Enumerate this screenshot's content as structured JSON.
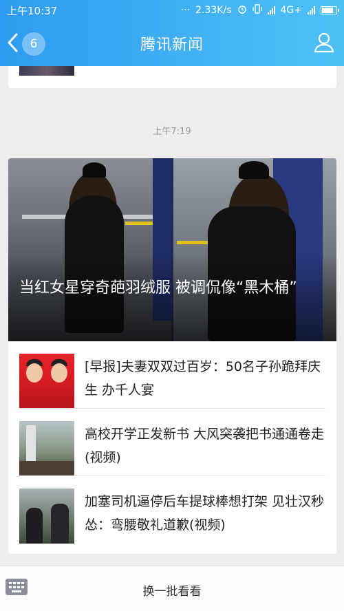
{
  "status_bar": {
    "time": "上午10:37",
    "speed": "2.33K/s",
    "network": "4G+"
  },
  "navbar": {
    "back_count": "6",
    "title": "腾讯新闻"
  },
  "timestamp": "上午7:19",
  "hero": {
    "headline": "当红女星穿奇葩羽绒服 被调侃像“黑木桶”"
  },
  "news_items": [
    {
      "title": "[早报]夫妻双双过百岁：50名子孙跪拜庆生 办千人宴"
    },
    {
      "title": "高校开学正发新书 大风突袭把书通通卷走(视频)"
    },
    {
      "title": "加塞司机逼停后车提球棒想打架 见壮汉秒怂：弯腰敬礼道歉(视频)"
    }
  ],
  "bottom": {
    "refresh_label": "换一批看看"
  },
  "colors": {
    "accent_start": "#2f9bf0",
    "accent_end": "#4fc1f5"
  }
}
